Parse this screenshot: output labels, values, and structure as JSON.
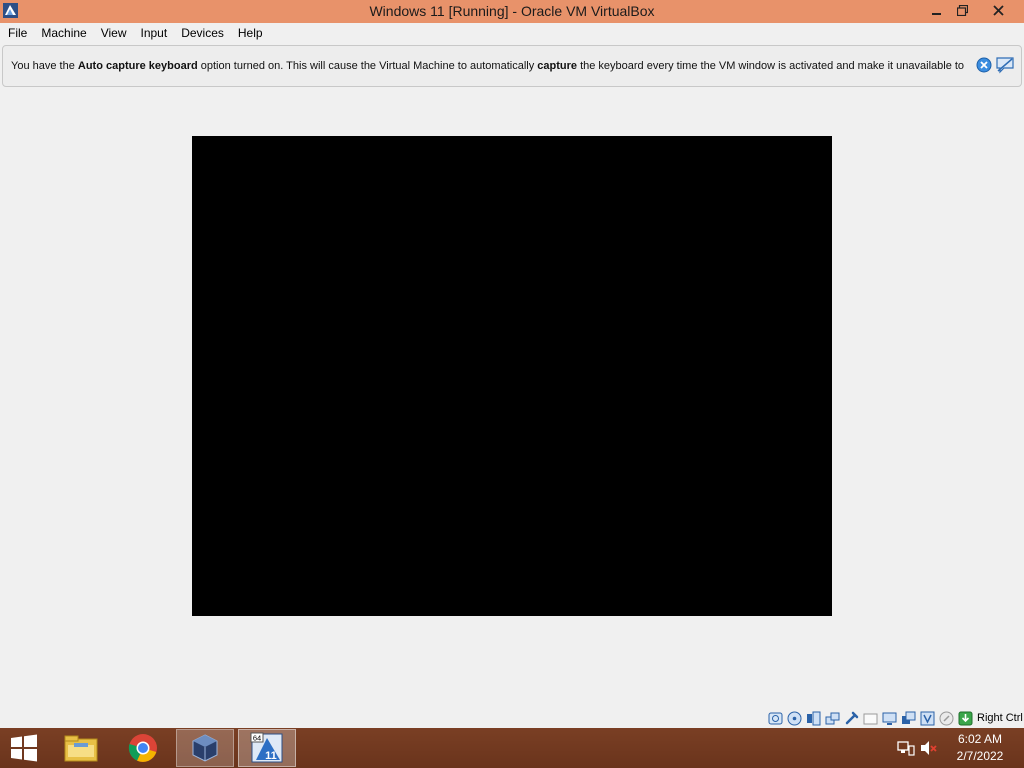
{
  "window": {
    "title": "Windows 11 [Running] - Oracle VM VirtualBox",
    "app_icon": "virtualbox-icon",
    "controls": [
      "minimize-icon",
      "restore-icon",
      "close-icon"
    ]
  },
  "menu": {
    "items": [
      {
        "label": "File"
      },
      {
        "label": "Machine"
      },
      {
        "label": "View"
      },
      {
        "label": "Input"
      },
      {
        "label": "Devices"
      },
      {
        "label": "Help"
      }
    ]
  },
  "banner": {
    "text_before": "You have the ",
    "bold_1": "Auto capture keyboard",
    "text_middle": " option turned on. This will cause the Virtual Machine to automatically ",
    "bold_2": "capture",
    "text_after": " the keyboard every time the VM window is activated and make it unavailable to",
    "close_icon": "close-message-icon",
    "dont_show_icon": "do-not-show-again-icon"
  },
  "vm_display": {
    "state": "black screen"
  },
  "statusbar": {
    "icons": [
      "hard-disk-icon",
      "optical-drive-icon",
      "audio-icon",
      "network-icon",
      "usb-icon",
      "shared-folders-icon",
      "display-icon",
      "recording-icon",
      "cpu-virtualization-icon",
      "mouse-integration-icon",
      "keyboard-capture-icon"
    ],
    "host_key": "Right Ctrl"
  },
  "taskbar": {
    "items": [
      "start-icon",
      "file-explorer-icon",
      "chrome-icon",
      "virtualbox-manager-icon",
      "windows-11-vm-icon"
    ],
    "vm_badge": "64",
    "vm_label": "11",
    "tray": [
      "network-icon",
      "volume-muted-icon"
    ],
    "time": "6:02 AM",
    "date": "2/7/2022"
  },
  "colors": {
    "titlebar": "#e8926a",
    "taskbar": "#6a341c",
    "vm_screen": "#000000",
    "background": "#f0f0f0"
  }
}
